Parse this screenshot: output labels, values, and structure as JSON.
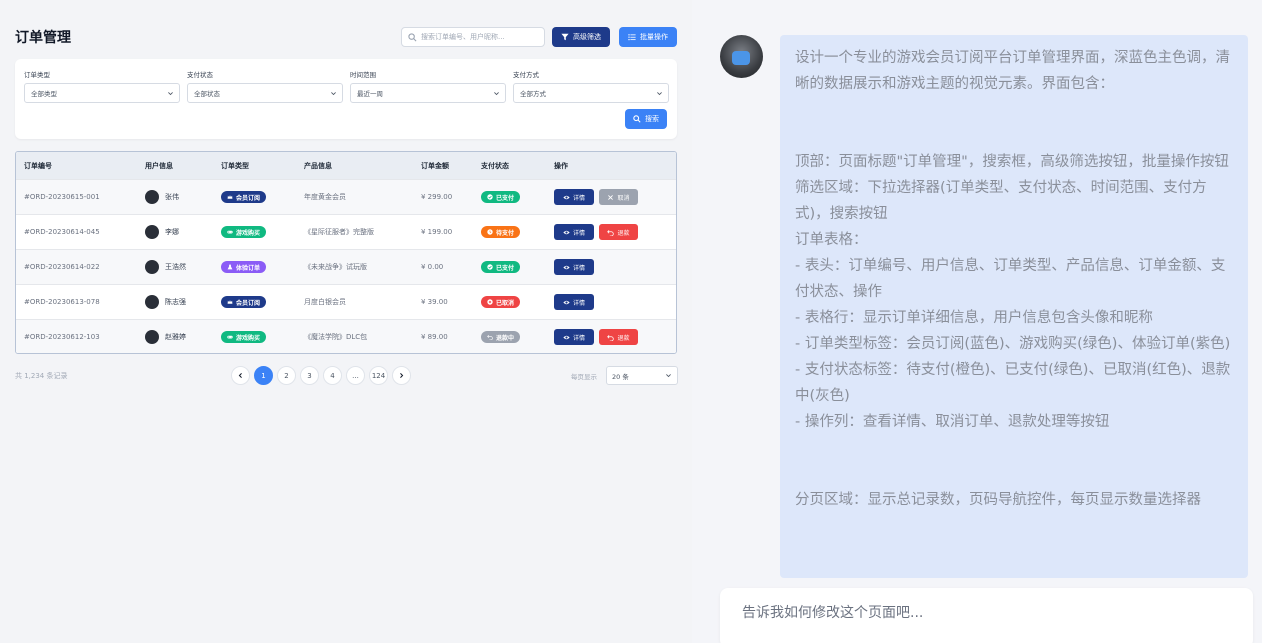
{
  "header": {
    "title": "订单管理",
    "search_placeholder": "搜索订单编号、用户昵称...",
    "advanced_filter_label": "高级筛选",
    "batch_label": "批量操作"
  },
  "filters": [
    {
      "label": "订单类型",
      "value": "全部类型"
    },
    {
      "label": "支付状态",
      "value": "全部状态"
    },
    {
      "label": "时间范围",
      "value": "最近一周"
    },
    {
      "label": "支付方式",
      "value": "全部方式"
    }
  ],
  "filter_search_label": "搜索",
  "table": {
    "columns": [
      "订单编号",
      "用户信息",
      "订单类型",
      "产品信息",
      "订单金额",
      "支付状态",
      "操作"
    ],
    "rows": [
      {
        "id": "#ORD-20230615-001",
        "user": "张伟",
        "type": "会员订阅",
        "type_color": "#1e3a8a",
        "type_icon": "crown-icon",
        "product": "年度黄金会员",
        "amount": "¥ 299.00",
        "status": "已支付",
        "status_color": "#10b981",
        "status_icon": "check-circle-icon",
        "actions": [
          {
            "label": "详情",
            "icon": "eye-icon",
            "color": "#1e3a8a"
          },
          {
            "label": "取消",
            "icon": "x-icon",
            "color": "#9ca3af"
          }
        ]
      },
      {
        "id": "#ORD-20230614-045",
        "user": "李娜",
        "type": "游戏购买",
        "type_color": "#10b981",
        "type_icon": "gamepad-icon",
        "product": "《星际征服者》完整版",
        "amount": "¥ 199.00",
        "status": "待支付",
        "status_color": "#f97316",
        "status_icon": "clock-icon",
        "actions": [
          {
            "label": "详情",
            "icon": "eye-icon",
            "color": "#1e3a8a"
          },
          {
            "label": "退款",
            "icon": "undo-icon",
            "color": "#ef4444"
          }
        ]
      },
      {
        "id": "#ORD-20230614-022",
        "user": "王浩然",
        "type": "体验订单",
        "type_color": "#8b5cf6",
        "type_icon": "flask-icon",
        "product": "《未来战争》试玩版",
        "amount": "¥ 0.00",
        "status": "已支付",
        "status_color": "#10b981",
        "status_icon": "check-circle-icon",
        "actions": [
          {
            "label": "详情",
            "icon": "eye-icon",
            "color": "#1e3a8a"
          }
        ]
      },
      {
        "id": "#ORD-20230613-078",
        "user": "陈志强",
        "type": "会员订阅",
        "type_color": "#1e3a8a",
        "type_icon": "crown-icon",
        "product": "月度白银会员",
        "amount": "¥ 39.00",
        "status": "已取消",
        "status_color": "#ef4444",
        "status_icon": "x-circle-icon",
        "actions": [
          {
            "label": "详情",
            "icon": "eye-icon",
            "color": "#1e3a8a"
          }
        ]
      },
      {
        "id": "#ORD-20230612-103",
        "user": "赵雅婷",
        "type": "游戏购买",
        "type_color": "#10b981",
        "type_icon": "gamepad-icon",
        "product": "《魔法学院》DLC包",
        "amount": "¥ 89.00",
        "status": "退款中",
        "status_color": "#9ca3af",
        "status_icon": "undo-icon",
        "actions": [
          {
            "label": "详情",
            "icon": "eye-icon",
            "color": "#1e3a8a"
          },
          {
            "label": "退款",
            "icon": "undo-icon",
            "color": "#ef4444"
          }
        ]
      }
    ]
  },
  "pagination": {
    "total": "共 1,234 条记录",
    "pages": [
      "1",
      "2",
      "3",
      "4",
      "...",
      "124"
    ],
    "active_page": "1",
    "per_page_label": "每页显示",
    "per_page_value": "20 条"
  },
  "chat": {
    "message": "设计一个专业的游戏会员订阅平台订单管理界面，深蓝色主色调，清晰的数据展示和游戏主题的视觉元素。界面包含：\n\n\n顶部：页面标题\"订单管理\"，搜索框，高级筛选按钮，批量操作按钮\n筛选区域：下拉选择器(订单类型、支付状态、时间范围、支付方式)，搜索按钮\n订单表格：\n- 表头：订单编号、用户信息、订单类型、产品信息、订单金额、支付状态、操作\n- 表格行：显示订单详细信息，用户信息包含头像和昵称\n- 订单类型标签：会员订阅(蓝色)、游戏购买(绿色)、体验订单(紫色)\n- 支付状态标签：待支付(橙色)、已支付(绿色)、已取消(红色)、退款中(灰色)\n- 操作列：查看详情、取消订单、退款处理等按钮\n\n\n分页区域：显示总记录数，页码导航控件，每页显示数量选择器",
    "input_placeholder": "告诉我如何修改这个页面吧..."
  }
}
